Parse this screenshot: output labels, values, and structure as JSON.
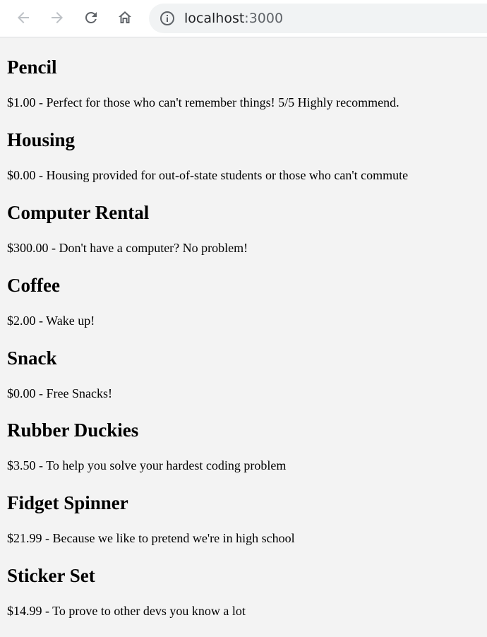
{
  "browser": {
    "back_icon": "arrow-left-icon",
    "forward_icon": "arrow-right-icon",
    "reload_icon": "reload-icon",
    "home_icon": "home-icon",
    "info_icon": "info-circle-icon",
    "url_host": "localhost",
    "url_port": ":3000"
  },
  "products": [
    {
      "name": "Pencil",
      "line": "$1.00 - Perfect for those who can't remember things! 5/5 Highly recommend."
    },
    {
      "name": "Housing",
      "line": "$0.00 - Housing provided for out-of-state students or those who can't commute"
    },
    {
      "name": "Computer Rental",
      "line": "$300.00 - Don't have a computer? No problem!"
    },
    {
      "name": "Coffee",
      "line": "$2.00 - Wake up!"
    },
    {
      "name": "Snack",
      "line": "$0.00 - Free Snacks!"
    },
    {
      "name": "Rubber Duckies",
      "line": "$3.50 - To help you solve your hardest coding problem"
    },
    {
      "name": "Fidget Spinner",
      "line": "$21.99 - Because we like to pretend we're in high school"
    },
    {
      "name": "Sticker Set",
      "line": "$14.99 - To prove to other devs you know a lot"
    }
  ]
}
